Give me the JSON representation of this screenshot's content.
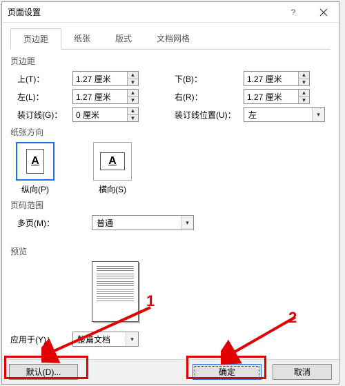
{
  "title": "页面设置",
  "tabs": [
    "页边距",
    "纸张",
    "版式",
    "文档网格"
  ],
  "margins": {
    "heading": "页边距",
    "top_label": "上(T)：",
    "top_value": "1.27 厘米",
    "bottom_label": "下(B)：",
    "bottom_value": "1.27 厘米",
    "left_label": "左(L)：",
    "left_value": "1.27 厘米",
    "right_label": "右(R)：",
    "right_value": "1.27 厘米",
    "gutter_label": "装订线(G)：",
    "gutter_value": "0 厘米",
    "gutter_pos_label": "装订线位置(U)：",
    "gutter_pos_value": "左"
  },
  "orientation": {
    "heading": "纸张方向",
    "portrait": "纵向(P)",
    "landscape": "横向(S)"
  },
  "pages": {
    "heading": "页码范围",
    "multi_label": "多页(M)：",
    "multi_value": "普通"
  },
  "preview": {
    "heading": "预览"
  },
  "apply": {
    "label": "应用于(Y)：",
    "value": "整篇文档"
  },
  "buttons": {
    "default": "默认(D)...",
    "ok": "确定",
    "cancel": "取消"
  },
  "callouts": {
    "one": "1",
    "two": "2"
  }
}
